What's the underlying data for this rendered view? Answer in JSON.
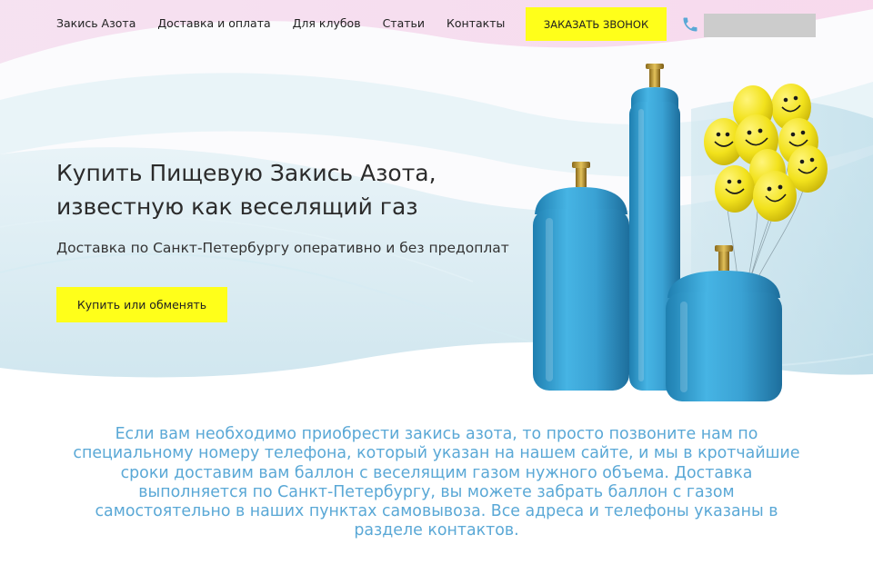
{
  "nav": {
    "items": [
      {
        "label": "Закись Азота"
      },
      {
        "label": "Доставка и оплата"
      },
      {
        "label": "Для клубов"
      },
      {
        "label": "Статьи"
      },
      {
        "label": "Контакты"
      }
    ],
    "call_button": "ЗАКАЗАТЬ ЗВОНОК",
    "phone_icon": "phone-icon"
  },
  "hero": {
    "title_line1": "Купить Пищевую Закись Азота,",
    "title_line2": "известную как веселящий газ",
    "subtitle": "Доставка по Санкт-Петербургу оперативно и без предоплат",
    "button": "Купить или обменять"
  },
  "info": {
    "text": "Если вам необходимо приобрести закись азота, то просто позвоните нам по специальному номеру телефона, который указан на нашем сайте, и мы в кротчайшие сроки доставим вам баллон с веселящим газом нужного объема. Доставка выполняется по Санкт-Петербургу, вы можете забрать баллон с газом самостоятельно в наших пунктах самовывоза. Все адреса и телефоны указаны в разделе контактов."
  },
  "colors": {
    "accent_yellow": "#ffff1a",
    "text_blue": "#5aa8d6",
    "cylinder_blue": "#3ba3d6",
    "balloon_yellow": "#f2e21c"
  }
}
